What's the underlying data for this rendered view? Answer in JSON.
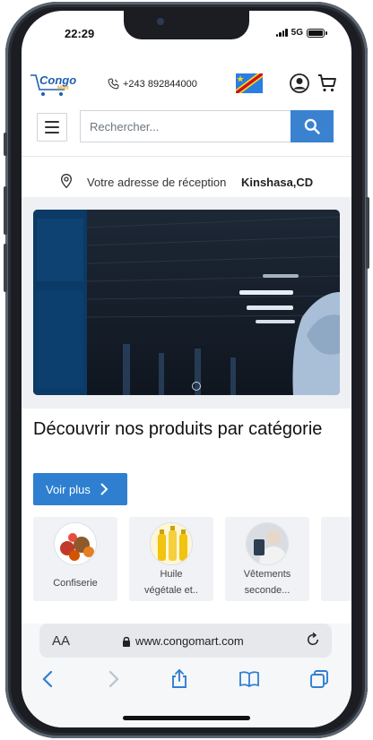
{
  "status_bar": {
    "time": "22:29",
    "network": "5G"
  },
  "header": {
    "logo_text": "Congo",
    "logo_sub": "Mart",
    "phone": "+243 892844000",
    "flag_icon": "drc-flag-icon",
    "account_icon": "user-icon",
    "cart_icon": "cart-icon"
  },
  "search": {
    "placeholder": "Rechercher...",
    "menu_icon": "hamburger-icon",
    "search_icon": "search-icon"
  },
  "address": {
    "label": "Votre adresse de réception",
    "city": "Kinshasa,CD"
  },
  "section": {
    "title": "Découvrir nos produits par catégorie",
    "more_button": "Voir plus"
  },
  "categories": [
    {
      "name_line1": "Confiserie",
      "name_line2": ""
    },
    {
      "name_line1": "Huile",
      "name_line2": "végétale et.."
    },
    {
      "name_line1": "Vêtements",
      "name_line2": "seconde..."
    }
  ],
  "browser": {
    "aa_label": "AA",
    "url": "www.congomart.com"
  },
  "colors": {
    "brand_blue": "#3a82d0",
    "button_blue": "#2f7fd1"
  }
}
